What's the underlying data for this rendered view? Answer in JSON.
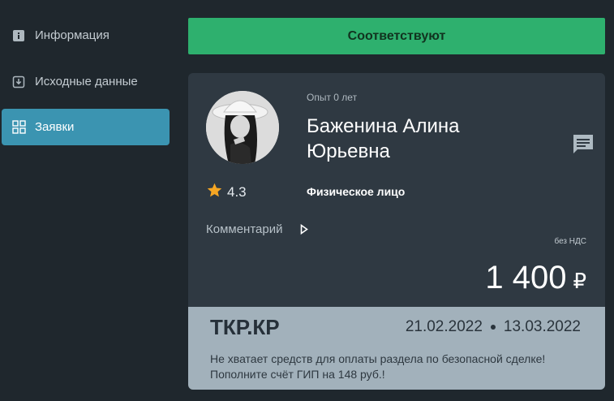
{
  "sidebar": {
    "items": [
      {
        "label": "Информация",
        "icon": "info-icon"
      },
      {
        "label": "Исходные данные",
        "icon": "download-box-icon"
      },
      {
        "label": "Заявки",
        "icon": "grid-icon",
        "active": true
      }
    ]
  },
  "banner": {
    "label": "Соответствуют",
    "color": "#2eb06e"
  },
  "card": {
    "experience": "Опыт 0 лет",
    "name": "Баженина Алина Юрьевна",
    "rating": "4.3",
    "entity_type": "Физическое лицо",
    "comment_label": "Комментарий",
    "vat_note": "без НДС",
    "price": "1 400",
    "currency": "₽"
  },
  "footer": {
    "code": "ТКР.КР",
    "date_start": "21.02.2022",
    "date_end": "13.03.2022",
    "warning": "Не хватает средств для оплаты раздела по безопасной сделке! Пополните счёт ГИП на 148 руб.!"
  },
  "colors": {
    "accent": "#3b94b1",
    "success": "#2eb06e",
    "star": "#f6a623"
  }
}
